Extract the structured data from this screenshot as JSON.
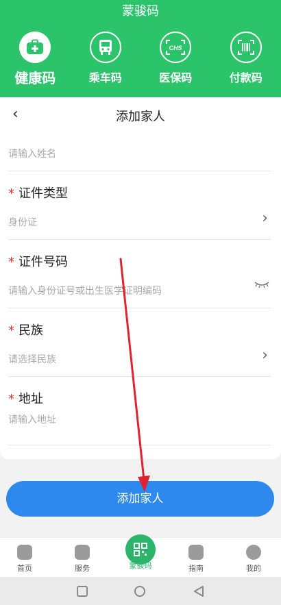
{
  "header": {
    "title": "蒙骏码"
  },
  "nav": [
    {
      "label": "健康码",
      "icon": "medical-kit-icon"
    },
    {
      "label": "乘车码",
      "icon": "bus-icon"
    },
    {
      "label": "医保码",
      "icon": "chs-icon"
    },
    {
      "label": "付款码",
      "icon": "barcode-icon"
    }
  ],
  "page": {
    "title": "添加家人"
  },
  "form": {
    "name_placeholder": "请输入姓名",
    "idtype_label": "证件类型",
    "idtype_value": "身份证",
    "idnum_label": "证件号码",
    "idnum_placeholder": "请输入身份证号或出生医学证明编码",
    "ethnic_label": "民族",
    "ethnic_placeholder": "请选择民族",
    "address_label": "地址",
    "address_placeholder": "请输入地址",
    "required_mark": "*"
  },
  "actions": {
    "submit_label": "添加家人"
  },
  "tabs": [
    {
      "label": "首页"
    },
    {
      "label": "服务"
    },
    {
      "label": "蒙骏码"
    },
    {
      "label": "指南"
    },
    {
      "label": "我的"
    }
  ],
  "colors": {
    "brand_green": "#2bc46a",
    "primary_blue": "#2d89ee",
    "required_red": "#e8302c",
    "annotation_red": "#e0232f"
  }
}
